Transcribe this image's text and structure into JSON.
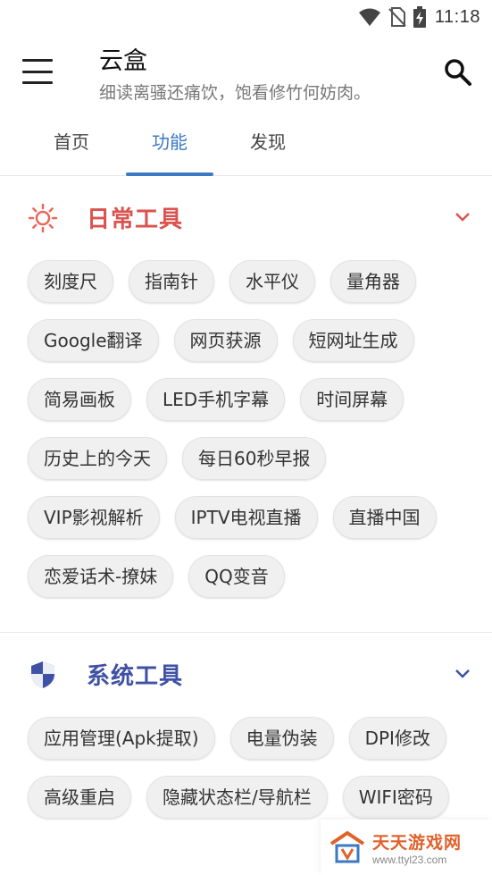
{
  "status_bar": {
    "time": "11:18",
    "icons": [
      "wifi-icon",
      "no-sim-icon",
      "battery-charging-icon"
    ]
  },
  "app_bar": {
    "title": "云盒",
    "subtitle": "细读离骚还痛饮，饱看修竹何妨肉。",
    "menu_icon": "hamburger-menu-icon",
    "search_icon": "search-icon"
  },
  "tabs": [
    {
      "label": "首页",
      "active": false
    },
    {
      "label": "功能",
      "active": true
    },
    {
      "label": "发现",
      "active": false
    }
  ],
  "sections": [
    {
      "title": "日常工具",
      "color": "#d9534f",
      "icon": "sun-icon",
      "expanded": true,
      "chips": [
        "刻度尺",
        "指南针",
        "水平仪",
        "量角器",
        "Google翻译",
        "网页获源",
        "短网址生成",
        "简易画板",
        "LED手机字幕",
        "时间屏幕",
        "历史上的今天",
        "每日60秒早报",
        "VIP影视解析",
        "IPTV电视直播",
        "直播中国",
        "恋爱话术-撩妹",
        "QQ变音"
      ]
    },
    {
      "title": "系统工具",
      "color": "#3f51a5",
      "icon": "shield-icon",
      "expanded": true,
      "chips": [
        "应用管理(Apk提取)",
        "电量伪装",
        "DPI修改",
        "高级重启",
        "隐藏状态栏/导航栏",
        "WIFI密码"
      ]
    }
  ],
  "watermark": {
    "main": "天天游戏网",
    "url": "www.ttyl23.com"
  },
  "colors": {
    "accent": "#3b79c5",
    "chip_bg": "#f0f0f0"
  }
}
